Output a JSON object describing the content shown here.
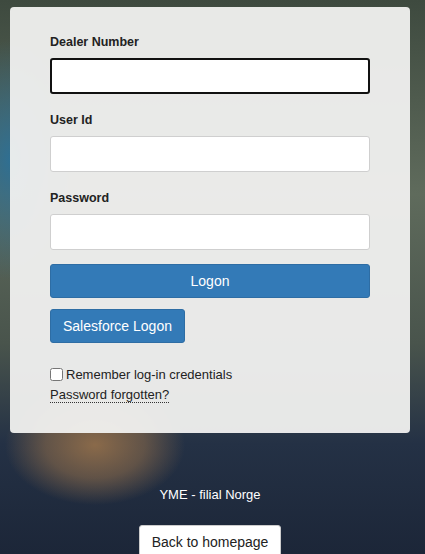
{
  "fields": [
    {
      "label": "Dealer Number",
      "value": "",
      "focused": true
    },
    {
      "label": "User Id",
      "value": "",
      "focused": false
    },
    {
      "label": "Password",
      "value": "",
      "focused": false
    }
  ],
  "buttons": {
    "logon": "Logon",
    "salesforce": "Salesforce Logon"
  },
  "remember": {
    "label": "Remember log-in credentials",
    "checked": false
  },
  "forgot": "Password forgotten?",
  "footer": {
    "branch": "YME - filial Norge",
    "back": "Back to homepage"
  }
}
